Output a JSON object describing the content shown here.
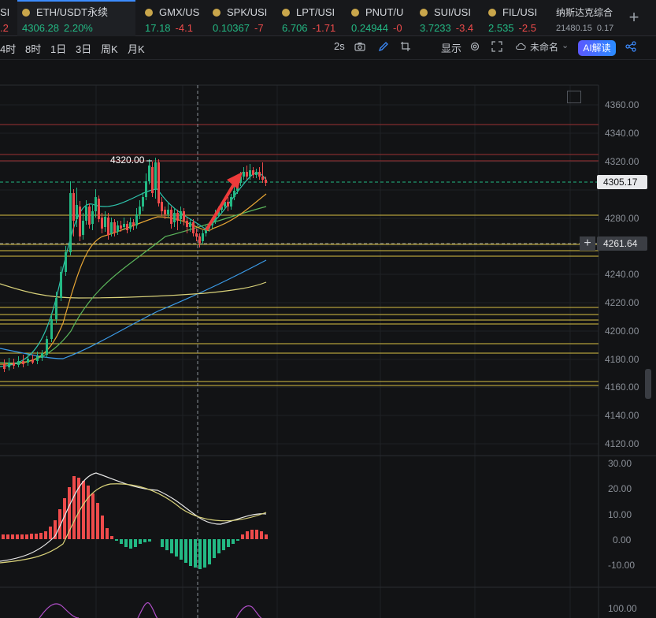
{
  "tabs": [
    {
      "symbol": "SI",
      "price": "",
      "change": ".2",
      "dir": "down"
    },
    {
      "symbol": "ETH/USDT永续",
      "price": "4306.28",
      "change": "2.20%",
      "dir": "up"
    },
    {
      "symbol": "GMX/US",
      "price": "17.18",
      "change": "-4.1",
      "dir": "down"
    },
    {
      "symbol": "SPK/USI",
      "price": "0.10367",
      "change": "-7",
      "dir": "down"
    },
    {
      "symbol": "LPT/USI",
      "price": "6.706",
      "change": "-1.71",
      "dir": "down"
    },
    {
      "symbol": "PNUT/U",
      "price": "0.24944",
      "change": "-0",
      "dir": "down"
    },
    {
      "symbol": "SUI/USI",
      "price": "3.7233",
      "change": "-3.4",
      "dir": "down"
    },
    {
      "symbol": "FIL/USI",
      "price": "2.535",
      "change": "-2.5",
      "dir": "down"
    },
    {
      "symbol": "纳斯达克综合",
      "price": "21480.15",
      "change": "0.17",
      "dir": "up"
    }
  ],
  "add_tab": "+",
  "timeframes": [
    "4时",
    "8时",
    "1日",
    "3日",
    "周K",
    "月K"
  ],
  "toolbar": {
    "interval": "2s",
    "display_label": "显示",
    "layout_name": "未命名",
    "ai_label": "AI解读"
  },
  "chart": {
    "high_marker": "4320.00",
    "last_price": "4305.17",
    "cursor_price": "4261.64",
    "price_ticks": [
      "4360.00",
      "4340.00",
      "4320.00",
      "4280.00",
      "4240.00",
      "4220.00",
      "4200.00",
      "4180.00",
      "4160.00",
      "4140.00",
      "4120.00"
    ],
    "macd_ticks": [
      "30.00",
      "20.00",
      "10.00",
      "0.00",
      "-10.00"
    ],
    "sub_tick": "100.00",
    "colors": {
      "up": "#23b984",
      "down": "#ee4b4b",
      "yellow": "#d9c243",
      "red_line": "#b83a3a"
    }
  }
}
